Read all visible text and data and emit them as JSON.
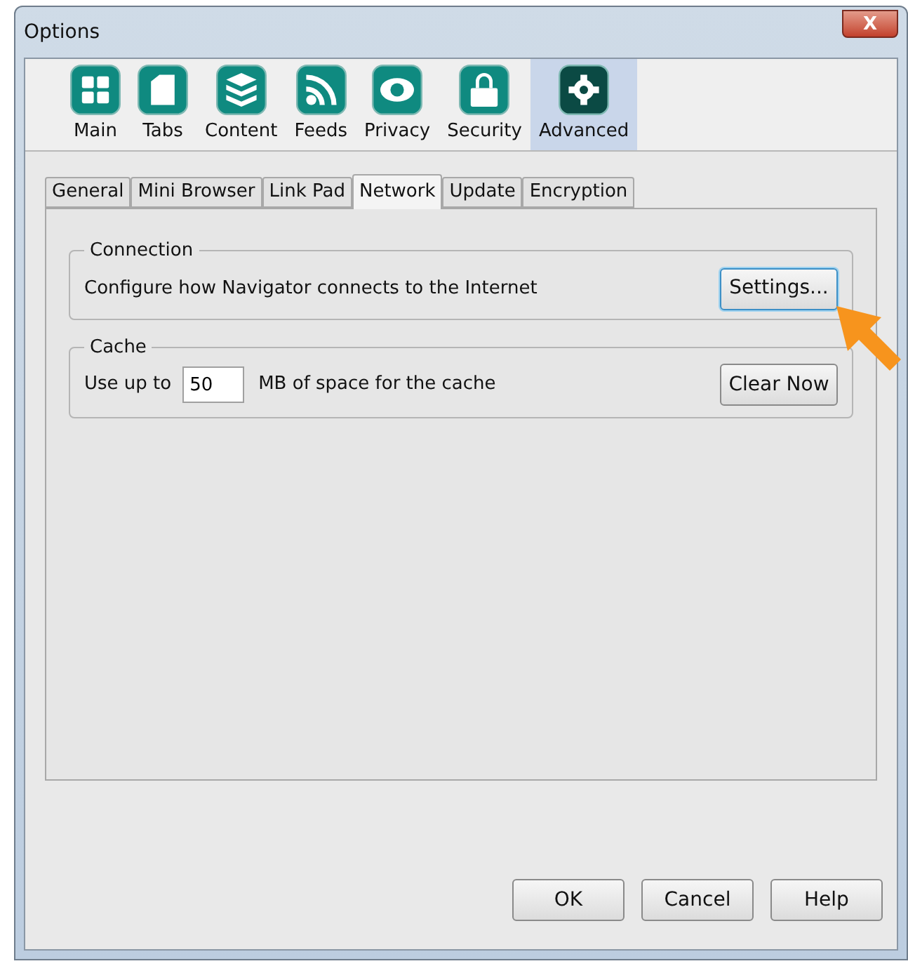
{
  "window": {
    "title": "Options",
    "close": "X"
  },
  "panes": [
    {
      "label": "Main",
      "selected": false
    },
    {
      "label": "Tabs",
      "selected": false
    },
    {
      "label": "Content",
      "selected": false
    },
    {
      "label": "Feeds",
      "selected": false
    },
    {
      "label": "Privacy",
      "selected": false
    },
    {
      "label": "Security",
      "selected": false
    },
    {
      "label": "Advanced",
      "selected": true
    }
  ],
  "tabs": [
    {
      "label": "General",
      "selected": false
    },
    {
      "label": "Mini Browser",
      "selected": false
    },
    {
      "label": "Link Pad",
      "selected": false
    },
    {
      "label": "Network",
      "selected": true
    },
    {
      "label": "Update",
      "selected": false
    },
    {
      "label": "Encryption",
      "selected": false
    }
  ],
  "connection": {
    "title": "Connection",
    "text": "Configure how Navigator connects to the Internet",
    "button": "Settings..."
  },
  "cache": {
    "title": "Cache",
    "prefix": "Use up to",
    "value": "50",
    "suffix": "MB of space for the cache",
    "button": "Clear Now"
  },
  "buttons": [
    "OK",
    "Cancel",
    "Help"
  ]
}
